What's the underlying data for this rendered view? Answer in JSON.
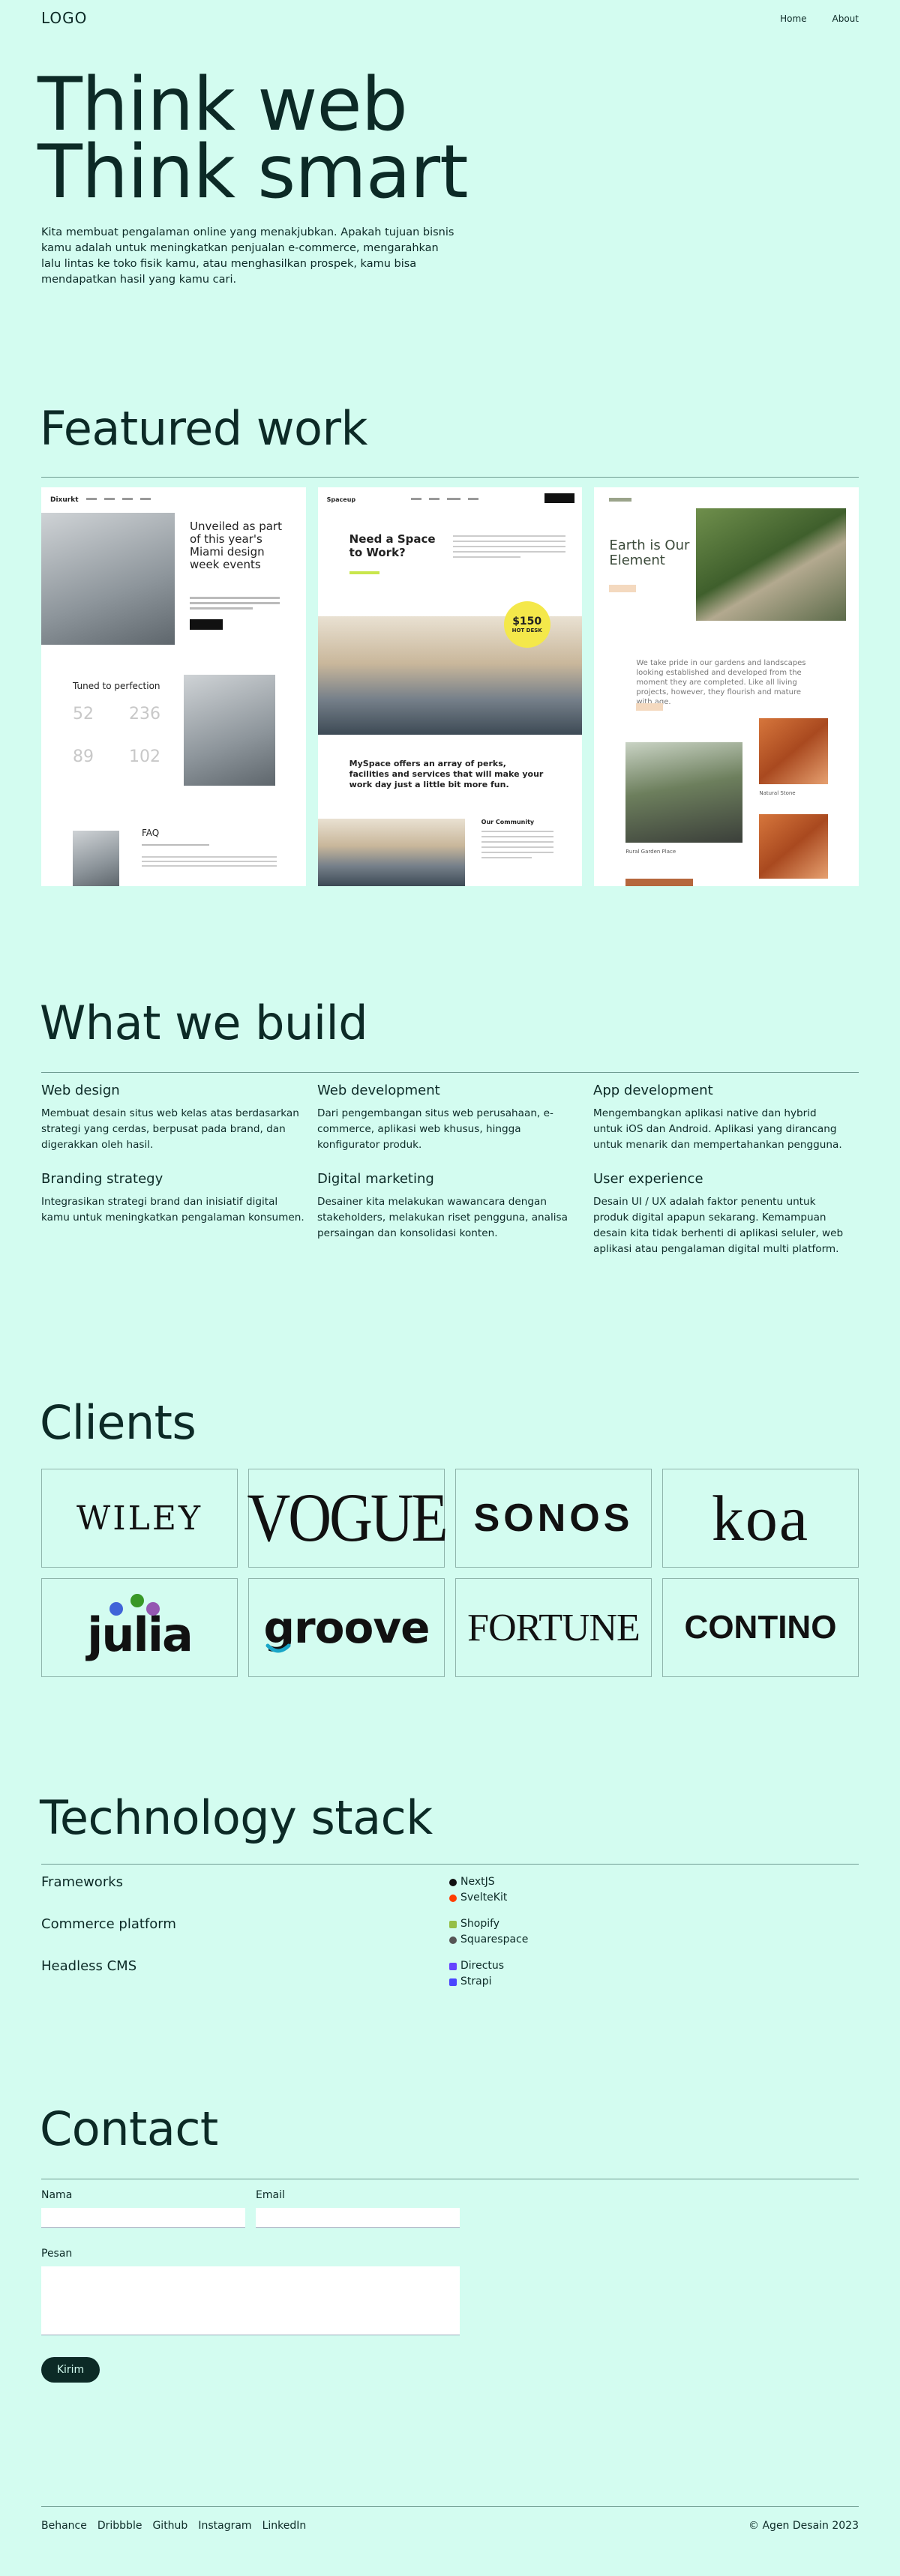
{
  "header": {
    "logo": "LOGO",
    "nav": [
      "Home",
      "About"
    ]
  },
  "hero": {
    "title_line1": "Think web",
    "title_line2": "Think smart",
    "text": "Kita membuat pengalaman online yang menakjubkan. Apakah tujuan bisnis kamu adalah untuk meningkatkan penjualan e-commerce, mengarahkan lalu lintas ke toko fisik kamu, atau menghasilkan prospek, kamu bisa mendapatkan hasil yang kamu cari."
  },
  "featured": {
    "title": "Featured work",
    "shot1": {
      "brand": "Dixurkt",
      "heading": "Unveiled as part of this year's Miami design week events",
      "subheading": "Tuned to perfection",
      "stats": [
        "52",
        "236",
        "89",
        "102"
      ],
      "faq": "FAQ"
    },
    "shot2": {
      "brand": "Spaceup",
      "heading": "Need a Space to Work?",
      "badge_price": "$150",
      "badge_text": "HOT DESK",
      "offer": "MySpace offers an array of perks, facilities and services that will make your work day just a little bit more fun.",
      "community": "Our Community"
    },
    "shot3": {
      "heading": "Earth is Our Element",
      "text": "We take pride in our gardens and landscapes looking established and developed from the moment they are completed. Like all living projects, however, they flourish and mature with age.",
      "caption1": "Natural Stone",
      "caption2": "Rural Garden Place"
    }
  },
  "build": {
    "title": "What we build",
    "services": [
      {
        "name": "Web design",
        "desc": "Membuat desain situs web kelas atas berdasarkan strategi yang cerdas, berpusat pada brand, dan digerakkan oleh hasil."
      },
      {
        "name": "Web development",
        "desc": "Dari pengembangan situs web perusahaan, e-commerce, aplikasi web khusus, hingga konfigurator produk."
      },
      {
        "name": "App development",
        "desc": "Mengembangkan aplikasi native dan hybrid untuk iOS dan Android. Aplikasi yang dirancang untuk menarik dan mempertahankan pengguna."
      },
      {
        "name": "Branding strategy",
        "desc": "Integrasikan strategi brand dan inisiatif digital kamu untuk meningkatkan pengalaman konsumen."
      },
      {
        "name": "Digital marketing",
        "desc": "Desainer kita melakukan wawancara dengan stakeholders, melakukan riset pengguna, analisa persaingan dan konsolidasi konten."
      },
      {
        "name": "User experience",
        "desc": "Desain UI / UX adalah faktor penentu untuk produk digital apapun sekarang. Kemampuan desain kita tidak berhenti di aplikasi seluler, web aplikasi atau pengalaman digital multi platform."
      }
    ]
  },
  "clients": {
    "title": "Clients",
    "logos": [
      "WILEY",
      "VOGUE",
      "SONOS",
      "koa",
      "julia",
      "groove",
      "FORTUNE",
      "CONTINO"
    ]
  },
  "tech": {
    "title": "Technology stack",
    "rows": [
      {
        "category": "Frameworks",
        "items": [
          "NextJS",
          "SvelteKit"
        ],
        "colors": [
          "#111111",
          "#ff3e00"
        ]
      },
      {
        "category": "Commerce platform",
        "items": [
          "Shopify",
          "Squarespace"
        ],
        "colors": [
          "#95bf47",
          "#555555"
        ]
      },
      {
        "category": "Headless CMS",
        "items": [
          "Directus",
          "Strapi"
        ],
        "colors": [
          "#6644ff",
          "#4945ff"
        ]
      }
    ]
  },
  "contact": {
    "title": "Contact",
    "name_label": "Nama",
    "email_label": "Email",
    "message_label": "Pesan",
    "send_label": "Kirim"
  },
  "footer": {
    "links": [
      "Behance",
      "Dribbble",
      "Github",
      "Instagram",
      "LinkedIn"
    ],
    "copyright": "© Agen Desain 2023"
  },
  "colors": {
    "background": "#d3fcf0",
    "ink": "#0c2a26",
    "badge": "#f4e84a"
  }
}
